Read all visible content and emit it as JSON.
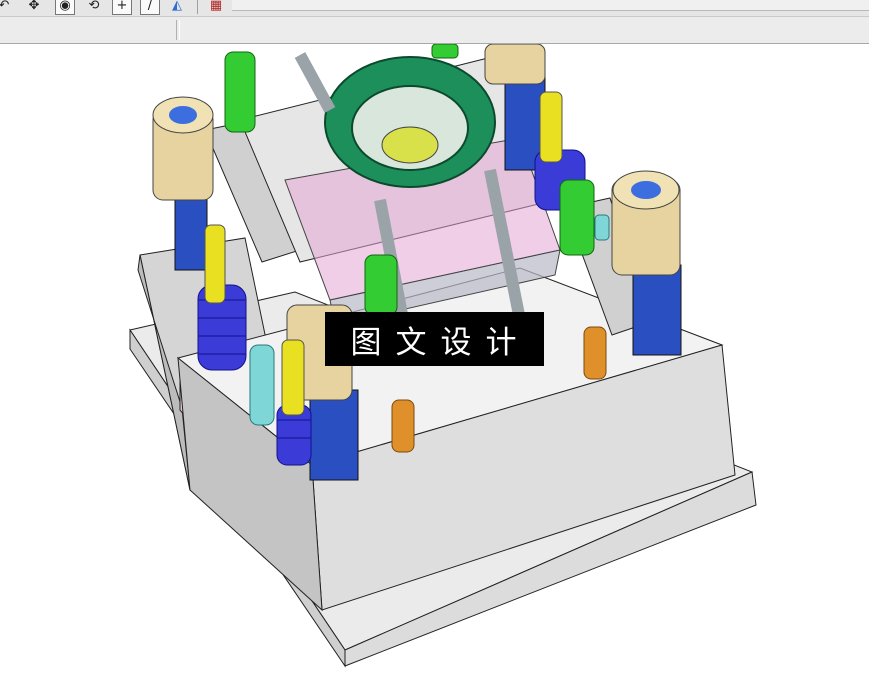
{
  "toolbar": {
    "buttons": [
      {
        "icon": "rotate-icon",
        "glyph": "↶"
      },
      {
        "icon": "pan-icon",
        "glyph": "✥"
      },
      {
        "icon": "target-icon",
        "glyph": "◉"
      },
      {
        "icon": "orbit-icon",
        "glyph": "⟲"
      },
      {
        "icon": "crosshair-icon",
        "glyph": "+"
      },
      {
        "icon": "line-icon",
        "glyph": "/"
      },
      {
        "icon": "view-cube-icon",
        "glyph": "◭"
      },
      {
        "icon": "grid-icon",
        "glyph": "▦"
      }
    ]
  },
  "watermark": {
    "text": "图文设计"
  },
  "colors": {
    "mold_plate": "#d9d9d9",
    "mold_plate_side": "#bdbdbd",
    "bushing": "#e6d3a0",
    "guide_pin": "#2a4fc0",
    "spring": "#3b3bd8",
    "screw": "#33cc33",
    "return_pin": "#e8e020",
    "locating_ring": "#1d8f5a",
    "cavity_insert": "#e6a6d6",
    "ejector_pin": "#9aa3a8",
    "dowel": "#e0902a",
    "cooling_plug": "#7fd6d6"
  }
}
